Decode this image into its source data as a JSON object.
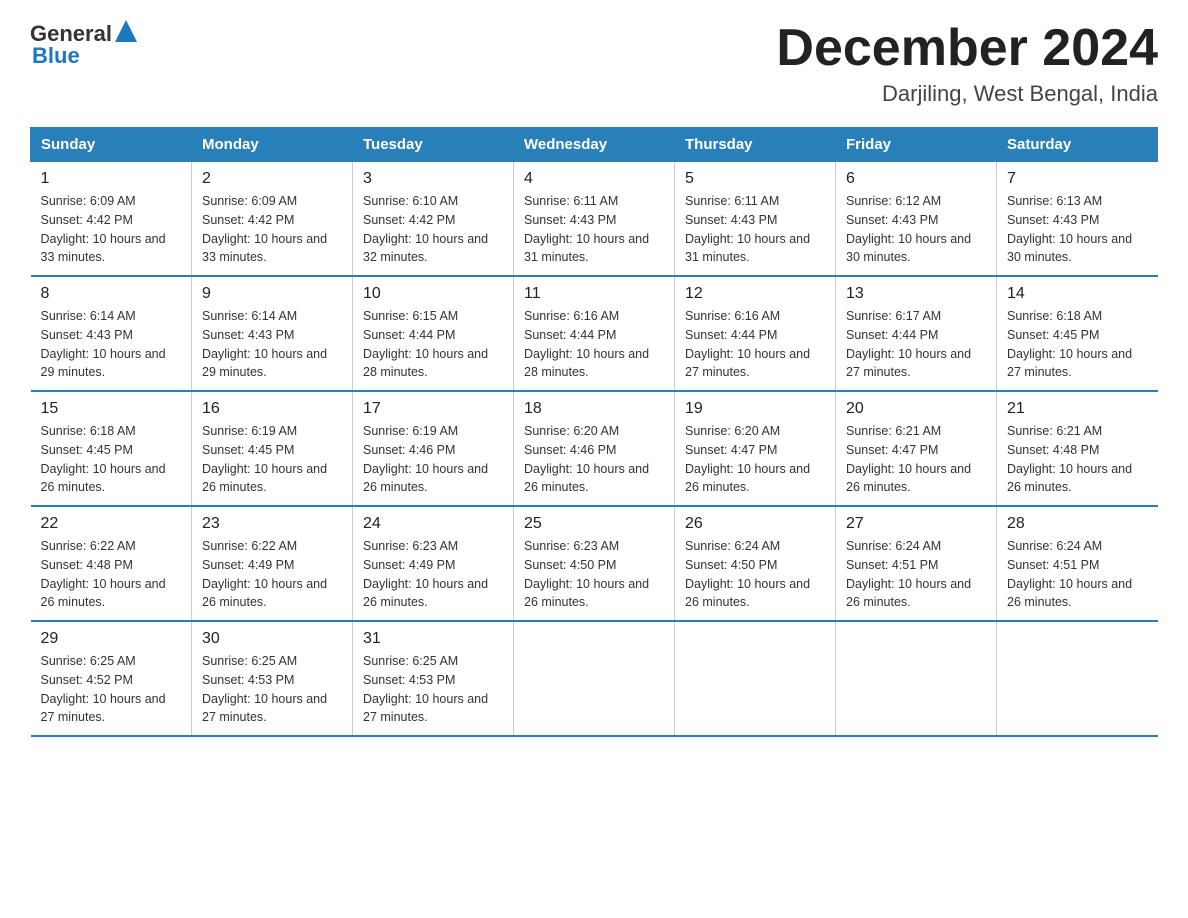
{
  "header": {
    "logo_general": "General",
    "logo_blue": "Blue",
    "title": "December 2024",
    "subtitle": "Darjiling, West Bengal, India"
  },
  "days_of_week": [
    "Sunday",
    "Monday",
    "Tuesday",
    "Wednesday",
    "Thursday",
    "Friday",
    "Saturday"
  ],
  "weeks": [
    [
      {
        "day": "1",
        "sunrise": "6:09 AM",
        "sunset": "4:42 PM",
        "daylight": "10 hours and 33 minutes."
      },
      {
        "day": "2",
        "sunrise": "6:09 AM",
        "sunset": "4:42 PM",
        "daylight": "10 hours and 33 minutes."
      },
      {
        "day": "3",
        "sunrise": "6:10 AM",
        "sunset": "4:42 PM",
        "daylight": "10 hours and 32 minutes."
      },
      {
        "day": "4",
        "sunrise": "6:11 AM",
        "sunset": "4:43 PM",
        "daylight": "10 hours and 31 minutes."
      },
      {
        "day": "5",
        "sunrise": "6:11 AM",
        "sunset": "4:43 PM",
        "daylight": "10 hours and 31 minutes."
      },
      {
        "day": "6",
        "sunrise": "6:12 AM",
        "sunset": "4:43 PM",
        "daylight": "10 hours and 30 minutes."
      },
      {
        "day": "7",
        "sunrise": "6:13 AM",
        "sunset": "4:43 PM",
        "daylight": "10 hours and 30 minutes."
      }
    ],
    [
      {
        "day": "8",
        "sunrise": "6:14 AM",
        "sunset": "4:43 PM",
        "daylight": "10 hours and 29 minutes."
      },
      {
        "day": "9",
        "sunrise": "6:14 AM",
        "sunset": "4:43 PM",
        "daylight": "10 hours and 29 minutes."
      },
      {
        "day": "10",
        "sunrise": "6:15 AM",
        "sunset": "4:44 PM",
        "daylight": "10 hours and 28 minutes."
      },
      {
        "day": "11",
        "sunrise": "6:16 AM",
        "sunset": "4:44 PM",
        "daylight": "10 hours and 28 minutes."
      },
      {
        "day": "12",
        "sunrise": "6:16 AM",
        "sunset": "4:44 PM",
        "daylight": "10 hours and 27 minutes."
      },
      {
        "day": "13",
        "sunrise": "6:17 AM",
        "sunset": "4:44 PM",
        "daylight": "10 hours and 27 minutes."
      },
      {
        "day": "14",
        "sunrise": "6:18 AM",
        "sunset": "4:45 PM",
        "daylight": "10 hours and 27 minutes."
      }
    ],
    [
      {
        "day": "15",
        "sunrise": "6:18 AM",
        "sunset": "4:45 PM",
        "daylight": "10 hours and 26 minutes."
      },
      {
        "day": "16",
        "sunrise": "6:19 AM",
        "sunset": "4:45 PM",
        "daylight": "10 hours and 26 minutes."
      },
      {
        "day": "17",
        "sunrise": "6:19 AM",
        "sunset": "4:46 PM",
        "daylight": "10 hours and 26 minutes."
      },
      {
        "day": "18",
        "sunrise": "6:20 AM",
        "sunset": "4:46 PM",
        "daylight": "10 hours and 26 minutes."
      },
      {
        "day": "19",
        "sunrise": "6:20 AM",
        "sunset": "4:47 PM",
        "daylight": "10 hours and 26 minutes."
      },
      {
        "day": "20",
        "sunrise": "6:21 AM",
        "sunset": "4:47 PM",
        "daylight": "10 hours and 26 minutes."
      },
      {
        "day": "21",
        "sunrise": "6:21 AM",
        "sunset": "4:48 PM",
        "daylight": "10 hours and 26 minutes."
      }
    ],
    [
      {
        "day": "22",
        "sunrise": "6:22 AM",
        "sunset": "4:48 PM",
        "daylight": "10 hours and 26 minutes."
      },
      {
        "day": "23",
        "sunrise": "6:22 AM",
        "sunset": "4:49 PM",
        "daylight": "10 hours and 26 minutes."
      },
      {
        "day": "24",
        "sunrise": "6:23 AM",
        "sunset": "4:49 PM",
        "daylight": "10 hours and 26 minutes."
      },
      {
        "day": "25",
        "sunrise": "6:23 AM",
        "sunset": "4:50 PM",
        "daylight": "10 hours and 26 minutes."
      },
      {
        "day": "26",
        "sunrise": "6:24 AM",
        "sunset": "4:50 PM",
        "daylight": "10 hours and 26 minutes."
      },
      {
        "day": "27",
        "sunrise": "6:24 AM",
        "sunset": "4:51 PM",
        "daylight": "10 hours and 26 minutes."
      },
      {
        "day": "28",
        "sunrise": "6:24 AM",
        "sunset": "4:51 PM",
        "daylight": "10 hours and 26 minutes."
      }
    ],
    [
      {
        "day": "29",
        "sunrise": "6:25 AM",
        "sunset": "4:52 PM",
        "daylight": "10 hours and 27 minutes."
      },
      {
        "day": "30",
        "sunrise": "6:25 AM",
        "sunset": "4:53 PM",
        "daylight": "10 hours and 27 minutes."
      },
      {
        "day": "31",
        "sunrise": "6:25 AM",
        "sunset": "4:53 PM",
        "daylight": "10 hours and 27 minutes."
      },
      null,
      null,
      null,
      null
    ]
  ]
}
